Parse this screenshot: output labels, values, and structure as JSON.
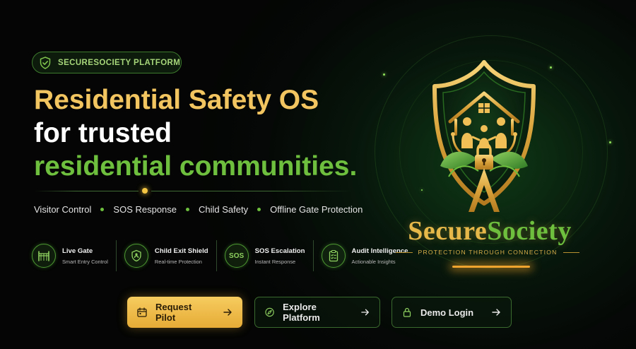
{
  "badge": {
    "label": "SECURESOCIETY PLATFORM",
    "icon": "shield-check-icon"
  },
  "headline": {
    "line1": "Residential Safety OS",
    "line2": "for trusted",
    "line3": "residential communities."
  },
  "features": [
    "Visitor Control",
    "SOS Response",
    "Child Safety",
    "Offline Gate Protection"
  ],
  "modules": [
    {
      "title": "Live Gate",
      "subtitle": "Smart Entry Control",
      "icon": "gate-icon"
    },
    {
      "title": "Child Exit Shield",
      "subtitle": "Real-time Protection",
      "icon": "child-shield-icon"
    },
    {
      "title": "SOS Escalation",
      "subtitle": "Instant Response",
      "icon": "sos-icon",
      "icon_text": "SOS"
    },
    {
      "title": "Audit Intelligence",
      "subtitle": "Actionable Insights",
      "icon": "clipboard-check-icon"
    }
  ],
  "buttons": {
    "request": {
      "label": "Request Pilot",
      "icon": "calendar-icon"
    },
    "explore": {
      "label": "Explore Platform",
      "icon": "compass-icon"
    },
    "demo": {
      "label": "Demo Login",
      "icon": "lock-icon"
    }
  },
  "logo": {
    "brand_part1": "Secure",
    "brand_part2": "Society",
    "tagline": "PROTECTION THROUGH CONNECTION"
  },
  "colors": {
    "gold": "#f3c560",
    "green": "#6dbf3d",
    "background": "#050806"
  }
}
